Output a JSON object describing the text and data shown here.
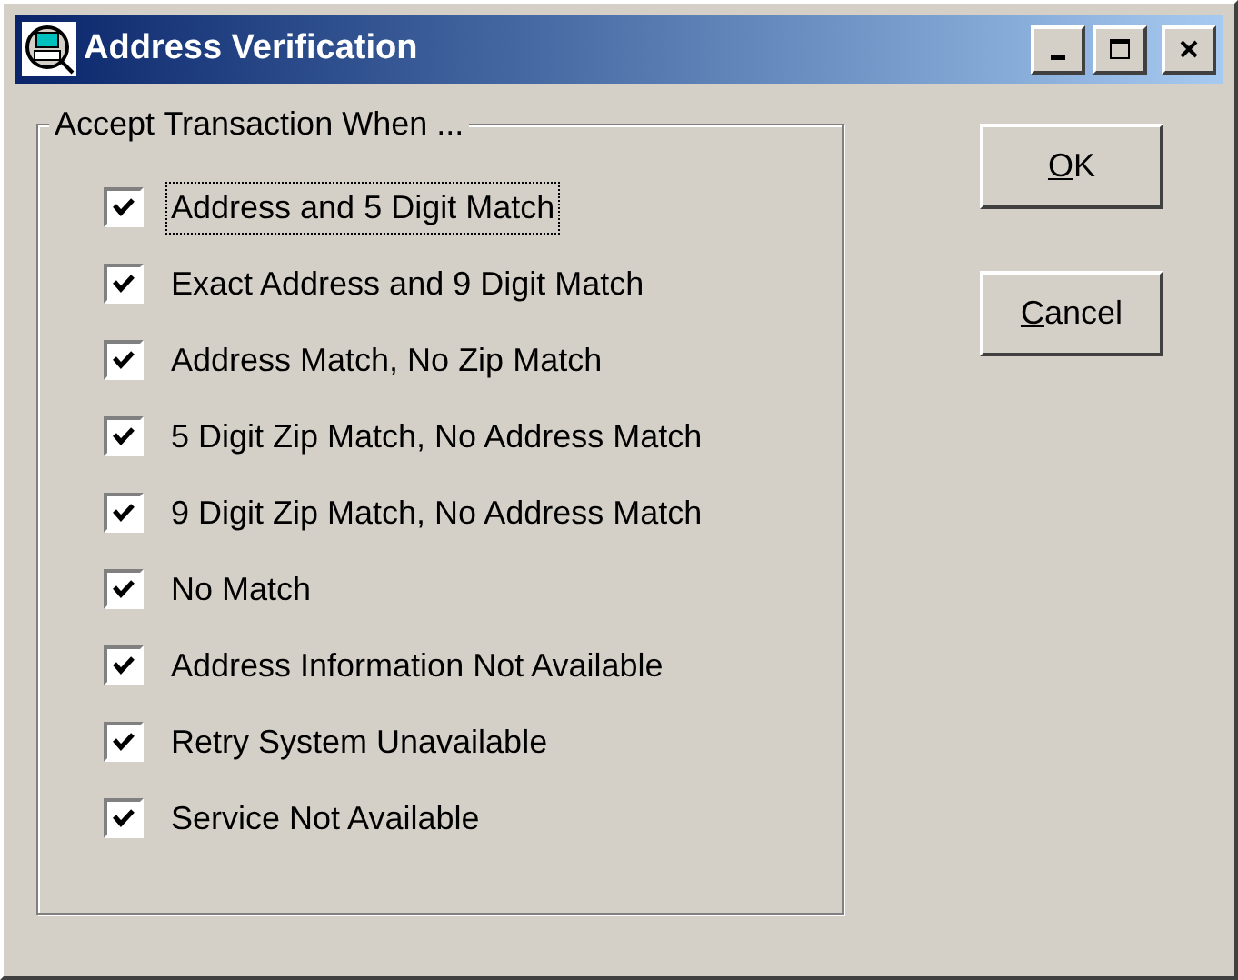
{
  "window": {
    "title": "Address Verification"
  },
  "group": {
    "title": "Accept Transaction When ...",
    "options": [
      {
        "label": "Address and 5 Digit Match",
        "checked": true,
        "focused": true
      },
      {
        "label": "Exact Address and 9 Digit Match",
        "checked": true,
        "focused": false
      },
      {
        "label": "Address Match, No Zip Match",
        "checked": true,
        "focused": false
      },
      {
        "label": "5 Digit Zip Match, No Address Match",
        "checked": true,
        "focused": false
      },
      {
        "label": "9 Digit Zip Match, No Address Match",
        "checked": true,
        "focused": false
      },
      {
        "label": "No Match",
        "checked": true,
        "focused": false
      },
      {
        "label": "Address Information Not Available",
        "checked": true,
        "focused": false
      },
      {
        "label": "Retry System Unavailable",
        "checked": true,
        "focused": false
      },
      {
        "label": "Service Not Available",
        "checked": true,
        "focused": false
      }
    ]
  },
  "buttons": [
    {
      "label": "OK",
      "underline_first": true
    },
    {
      "label": "Cancel",
      "underline_first": true
    }
  ]
}
